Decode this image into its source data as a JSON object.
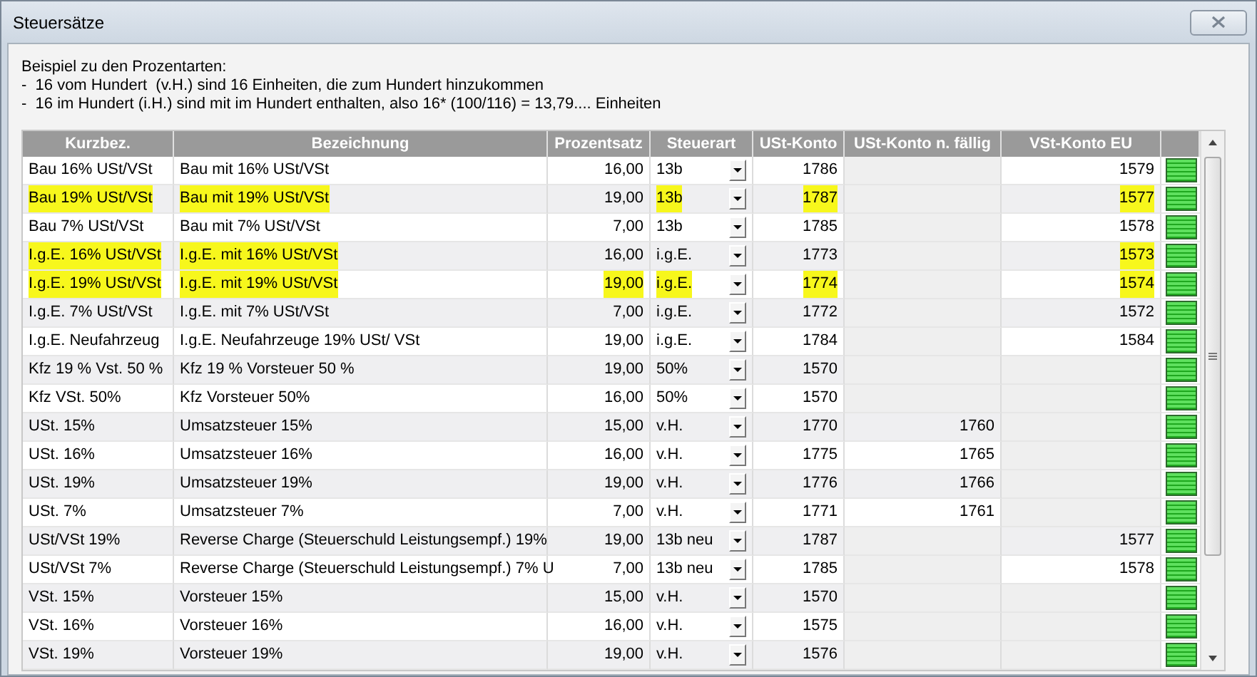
{
  "window": {
    "title": "Steuersätze"
  },
  "intro": [
    "Beispiel zu den Prozentarten:",
    "-  16 vom Hundert  (v.H.) sind 16 Einheiten, die zum Hundert hinzukommen",
    "-  16 im Hundert (i.H.) sind mit im Hundert enthalten, also 16* (100/116) = 13,79.... Einheiten"
  ],
  "table": {
    "columns": [
      "Kurzbez.",
      "Bezeichnung",
      "Prozentsatz",
      "Steuerart",
      "USt-Konto",
      "USt-Konto n. fällig",
      "VSt-Konto EU"
    ],
    "rows": [
      {
        "cells": [
          {
            "text": "Bau 16% USt/VSt",
            "marked": false
          },
          {
            "text": "Bau mit 16% USt/VSt",
            "marked": false
          },
          {
            "text": "16,00",
            "marked": false
          },
          {
            "text": "13b",
            "marked": false
          },
          {
            "text": "1786",
            "marked": false
          },
          null,
          {
            "text": "1579",
            "marked": false
          }
        ]
      },
      {
        "cells": [
          {
            "text": "Bau 19% USt/VSt",
            "marked": true
          },
          {
            "text": "Bau mit 19% USt/VSt",
            "marked": true
          },
          {
            "text": "19,00",
            "marked": false
          },
          {
            "text": "13b",
            "marked": true
          },
          {
            "text": "1787",
            "marked": true
          },
          null,
          {
            "text": "1577",
            "marked": true
          }
        ]
      },
      {
        "cells": [
          {
            "text": "Bau 7% USt/VSt",
            "marked": false
          },
          {
            "text": "Bau mit 7% USt/VSt",
            "marked": false
          },
          {
            "text": "7,00",
            "marked": false
          },
          {
            "text": "13b",
            "marked": false
          },
          {
            "text": "1785",
            "marked": false
          },
          null,
          {
            "text": "1578",
            "marked": false
          }
        ]
      },
      {
        "cells": [
          {
            "text": "I.g.E. 16% USt/VSt",
            "marked": true
          },
          {
            "text": "I.g.E. mit 16% USt/VSt",
            "marked": true
          },
          {
            "text": "16,00",
            "marked": false
          },
          {
            "text": "i.g.E.",
            "marked": false
          },
          {
            "text": "1773",
            "marked": false
          },
          null,
          {
            "text": "1573",
            "marked": true
          }
        ]
      },
      {
        "cells": [
          {
            "text": "I.g.E. 19% USt/VSt",
            "marked": true
          },
          {
            "text": "I.g.E. mit 19% USt/VSt",
            "marked": true
          },
          {
            "text": "19,00",
            "marked": true
          },
          {
            "text": "i.g.E.",
            "marked": true
          },
          {
            "text": "1774",
            "marked": true
          },
          null,
          {
            "text": "1574",
            "marked": true
          }
        ]
      },
      {
        "cells": [
          {
            "text": "I.g.E. 7% USt/VSt",
            "marked": false
          },
          {
            "text": "I.g.E. mit 7% USt/VSt",
            "marked": false
          },
          {
            "text": "7,00",
            "marked": false
          },
          {
            "text": "i.g.E.",
            "marked": false
          },
          {
            "text": "1772",
            "marked": false
          },
          null,
          {
            "text": "1572",
            "marked": false
          }
        ]
      },
      {
        "cells": [
          {
            "text": "I.g.E. Neufahrzeug",
            "marked": false
          },
          {
            "text": "I.g.E. Neufahrzeuge 19% USt/ VSt",
            "marked": false
          },
          {
            "text": "19,00",
            "marked": false
          },
          {
            "text": "i.g.E.",
            "marked": false
          },
          {
            "text": "1784",
            "marked": false
          },
          null,
          {
            "text": "1584",
            "marked": false
          }
        ]
      },
      {
        "cells": [
          {
            "text": "Kfz 19 % Vst. 50 %",
            "marked": false
          },
          {
            "text": "Kfz 19 % Vorsteuer 50 %",
            "marked": false
          },
          {
            "text": "19,00",
            "marked": false
          },
          {
            "text": "50%",
            "marked": false
          },
          {
            "text": "1570",
            "marked": false
          },
          null,
          null
        ]
      },
      {
        "cells": [
          {
            "text": "Kfz VSt. 50%",
            "marked": false
          },
          {
            "text": "Kfz Vorsteuer 50%",
            "marked": false
          },
          {
            "text": "16,00",
            "marked": false
          },
          {
            "text": "50%",
            "marked": false
          },
          {
            "text": "1570",
            "marked": false
          },
          null,
          null
        ]
      },
      {
        "cells": [
          {
            "text": "USt. 15%",
            "marked": false
          },
          {
            "text": "Umsatzsteuer 15%",
            "marked": false
          },
          {
            "text": "15,00",
            "marked": false
          },
          {
            "text": "v.H.",
            "marked": false
          },
          {
            "text": "1770",
            "marked": false
          },
          {
            "text": "1760",
            "marked": false
          },
          null
        ]
      },
      {
        "cells": [
          {
            "text": "USt. 16%",
            "marked": false
          },
          {
            "text": "Umsatzsteuer 16%",
            "marked": false
          },
          {
            "text": "16,00",
            "marked": false
          },
          {
            "text": "v.H.",
            "marked": false
          },
          {
            "text": "1775",
            "marked": false
          },
          {
            "text": "1765",
            "marked": false
          },
          null
        ]
      },
      {
        "cells": [
          {
            "text": "USt. 19%",
            "marked": false
          },
          {
            "text": "Umsatzsteuer 19%",
            "marked": false
          },
          {
            "text": "19,00",
            "marked": false
          },
          {
            "text": "v.H.",
            "marked": false
          },
          {
            "text": "1776",
            "marked": false
          },
          {
            "text": "1766",
            "marked": false
          },
          null
        ]
      },
      {
        "cells": [
          {
            "text": "USt. 7%",
            "marked": false
          },
          {
            "text": "Umsatzsteuer 7%",
            "marked": false
          },
          {
            "text": "7,00",
            "marked": false
          },
          {
            "text": "v.H.",
            "marked": false
          },
          {
            "text": "1771",
            "marked": false
          },
          {
            "text": "1761",
            "marked": false
          },
          null
        ]
      },
      {
        "cells": [
          {
            "text": "USt/VSt 19%",
            "marked": false
          },
          {
            "text": "Reverse Charge (Steuerschuld Leistungsempf.) 19%",
            "marked": false
          },
          {
            "text": "19,00",
            "marked": false
          },
          {
            "text": "13b neu",
            "marked": false
          },
          {
            "text": "1787",
            "marked": false
          },
          null,
          {
            "text": "1577",
            "marked": false
          }
        ]
      },
      {
        "cells": [
          {
            "text": "USt/VSt 7%",
            "marked": false
          },
          {
            "text": "Reverse Charge (Steuerschuld Leistungsempf.) 7% U",
            "marked": false
          },
          {
            "text": "7,00",
            "marked": false
          },
          {
            "text": "13b neu",
            "marked": false
          },
          {
            "text": "1785",
            "marked": false
          },
          null,
          {
            "text": "1578",
            "marked": false
          }
        ]
      },
      {
        "cells": [
          {
            "text": "VSt. 15%",
            "marked": false
          },
          {
            "text": "Vorsteuer 15%",
            "marked": false
          },
          {
            "text": "15,00",
            "marked": false
          },
          {
            "text": "v.H.",
            "marked": false
          },
          {
            "text": "1570",
            "marked": false
          },
          null,
          null
        ]
      },
      {
        "cells": [
          {
            "text": "VSt. 16%",
            "marked": false
          },
          {
            "text": "Vorsteuer 16%",
            "marked": false
          },
          {
            "text": "16,00",
            "marked": false
          },
          {
            "text": "v.H.",
            "marked": false
          },
          {
            "text": "1575",
            "marked": false
          },
          null,
          null
        ]
      },
      {
        "cells": [
          {
            "text": "VSt. 19%",
            "marked": false
          },
          {
            "text": "Vorsteuer 19%",
            "marked": false
          },
          {
            "text": "19,00",
            "marked": false
          },
          {
            "text": "v.H.",
            "marked": false
          },
          {
            "text": "1576",
            "marked": false
          },
          null,
          null
        ]
      }
    ]
  }
}
